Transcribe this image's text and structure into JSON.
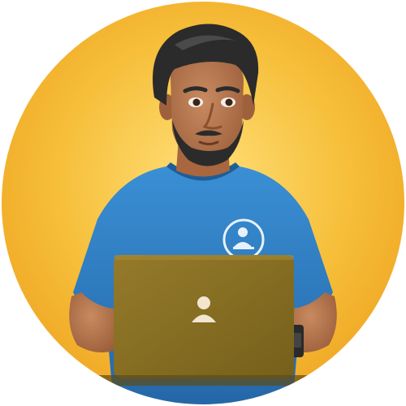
{
  "avatar": {
    "subject": "developer-avatar",
    "background_color": "#f3b52a",
    "background_highlight": "#ffd966",
    "skin_color": "#b8764f",
    "hair_color": "#2b2b2b",
    "shirt_color": "#2f7fc4",
    "laptop_color": "#8a6e22",
    "icons": [
      "person-logo-icon",
      "user-icon",
      "watch-icon"
    ]
  }
}
